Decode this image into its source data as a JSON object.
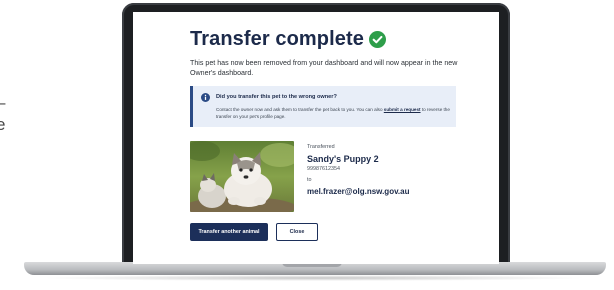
{
  "left_fragments": [
    "–",
    "e"
  ],
  "page": {
    "title": "Transfer complete",
    "intro": "This pet has now been removed from your dashboard and will now appear in the new Owner's dashboard."
  },
  "notice": {
    "title": "Did you transfer this pet to the wrong owner?",
    "body_before": "Contact the owner now and ask them to transfer the pet back to you. You can also ",
    "link_text": "submit a request",
    "body_after": " to reverse the transfer on your pet's profile page."
  },
  "transfer": {
    "status_label": "Transferred",
    "pet_name": "Sandy's Puppy 2",
    "pet_id": "99987612354",
    "to_label": "to",
    "owner_email": "mel.frazer@olg.nsw.gov.au"
  },
  "buttons": {
    "transfer_another": "Transfer another animal",
    "close": "Close"
  },
  "colors": {
    "navy": "#1c2f5a",
    "success_green": "#2e9e4a",
    "notice_bg": "#e8eef8",
    "laptop_frame": "#1d1f22"
  },
  "icons": {
    "success": "check-circle-icon",
    "info": "info-circle-icon"
  }
}
